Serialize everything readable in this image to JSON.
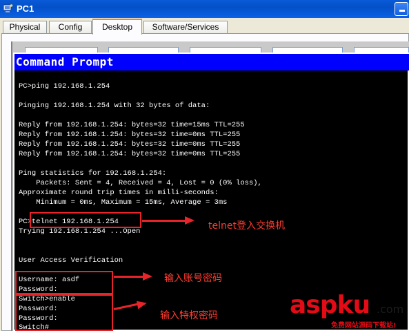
{
  "window": {
    "title": "PC1",
    "close_glyph": "minimize-icon",
    "title_bar_color": "#0350c8"
  },
  "tabs": [
    {
      "label": "Physical",
      "active": false
    },
    {
      "label": "Config",
      "active": false
    },
    {
      "label": "Desktop",
      "active": true
    },
    {
      "label": "Software/Services",
      "active": false
    }
  ],
  "command_prompt": {
    "title": "Command Prompt",
    "header_color": "#0000fe",
    "lines": [
      "PC>ping 192.168.1.254",
      "Pinging 192.168.1.254 with 32 bytes of data:",
      "Reply from 192.168.1.254: bytes=32 time=15ms TTL=255",
      "Reply from 192.168.1.254: bytes=32 time=0ms TTL=255",
      "Reply from 192.168.1.254: bytes=32 time=0ms TTL=255",
      "Reply from 192.168.1.254: bytes=32 time=0ms TTL=255",
      "Ping statistics for 192.168.1.254:",
      "    Packets: Sent = 4, Received = 4, Lost = 0 (0% loss),",
      "Approximate round trip times in milli-seconds:",
      "    Minimum = 0ms, Maximum = 15ms, Average = 3ms",
      "PC>telnet 192.168.1.254",
      "Trying 192.168.1.254 ...Open",
      "User Access Verification",
      "Username: asdf",
      "Password:",
      "Switch>enable",
      "Password:",
      "Password:",
      "Switch#"
    ]
  },
  "annotations": [
    {
      "text": "telnet登入交换机"
    },
    {
      "text": "输入账号密码"
    },
    {
      "text": "输入特权密码"
    }
  ],
  "annotation_color": "#e8242b",
  "watermark": {
    "main_black": "asp",
    "main_red": "ku",
    "suffix": ".com",
    "subtitle": "免费网站源码下载站!"
  }
}
